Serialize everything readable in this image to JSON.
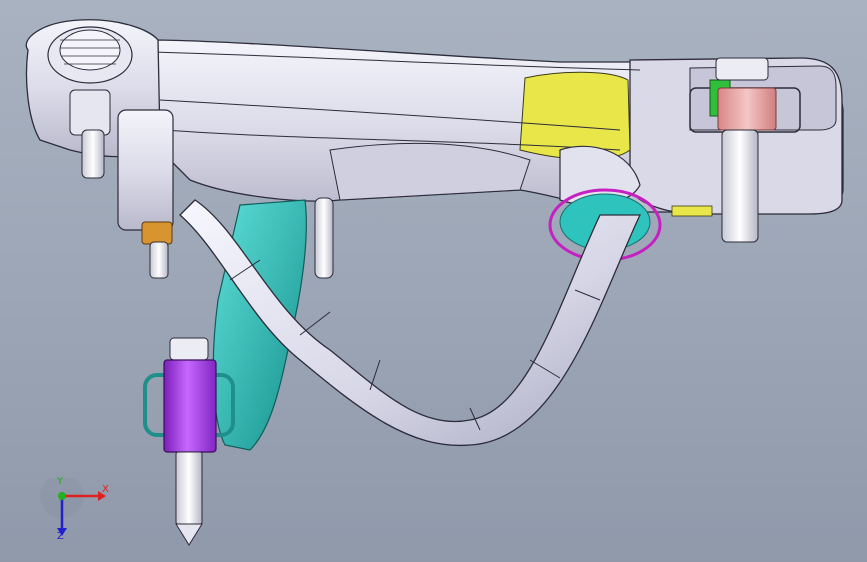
{
  "triad": {
    "x_label": "X",
    "y_label": "Y",
    "z_label": "Z"
  },
  "colors": {
    "background": "#9ea8b7",
    "arm_body": "#e6e6f2",
    "arm_edge": "#2c2c3a",
    "teal_bracket": "#2fc3bd",
    "yellow_insert": "#e9e64a",
    "bushing_purple": "#a33ae0",
    "bushing_pink": "#e8a6a6",
    "brass_nut": "#d8952f",
    "magenta_ring": "#c61fc2",
    "axis_x": "#e02020",
    "axis_y": "#20b020",
    "axis_z": "#2020d0"
  }
}
